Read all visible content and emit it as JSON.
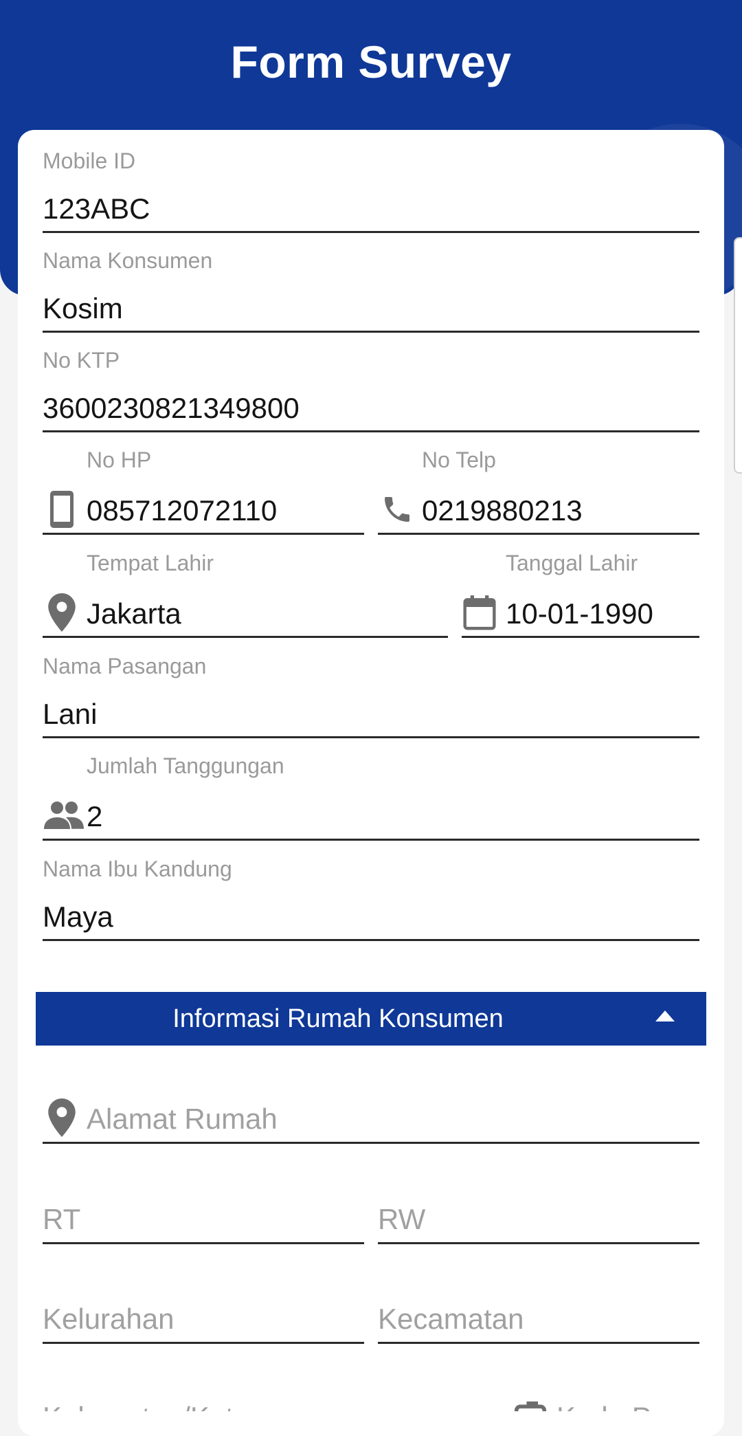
{
  "header": {
    "title": "Form Survey"
  },
  "form": {
    "mobile_id": {
      "label": "Mobile ID",
      "value": "123ABC"
    },
    "nama_konsumen": {
      "label": "Nama Konsumen",
      "value": "Kosim"
    },
    "no_ktp": {
      "label": "No KTP",
      "value": "3600230821349800"
    },
    "no_hp": {
      "label": "No HP",
      "value": "085712072110",
      "icon": "smartphone-icon"
    },
    "no_telp": {
      "label": "No Telp",
      "value": "0219880213",
      "icon": "phone-icon"
    },
    "tempat_lahir": {
      "label": "Tempat Lahir",
      "value": "Jakarta",
      "icon": "location-pin-icon"
    },
    "tanggal_lahir": {
      "label": "Tanggal Lahir",
      "value": "10-01-1990",
      "icon": "calendar-icon"
    },
    "nama_pasangan": {
      "label": "Nama Pasangan",
      "value": "Lani"
    },
    "jumlah_tanggungan": {
      "label": "Jumlah Tanggungan",
      "value": "2",
      "icon": "people-icon"
    },
    "nama_ibu_kandung": {
      "label": "Nama Ibu Kandung",
      "value": "Maya"
    }
  },
  "section": {
    "title": "Informasi Rumah Konsumen",
    "toggle_icon": "caret-up-icon"
  },
  "rumah": {
    "alamat": {
      "placeholder": "Alamat Rumah",
      "icon": "location-pin-icon"
    },
    "rt": {
      "placeholder": "RT"
    },
    "rw": {
      "placeholder": "RW"
    },
    "kelurahan": {
      "placeholder": "Kelurahan"
    },
    "kecamatan": {
      "placeholder": "Kecamatan"
    },
    "kabupaten": {
      "placeholder": "Kabupaten/Kota"
    },
    "kode_pos": {
      "placeholder": "Kode Pos",
      "icon": "mailbox-icon"
    }
  },
  "colors": {
    "primary": "#0f3897",
    "label": "#9a9a9a",
    "text": "#141414"
  }
}
